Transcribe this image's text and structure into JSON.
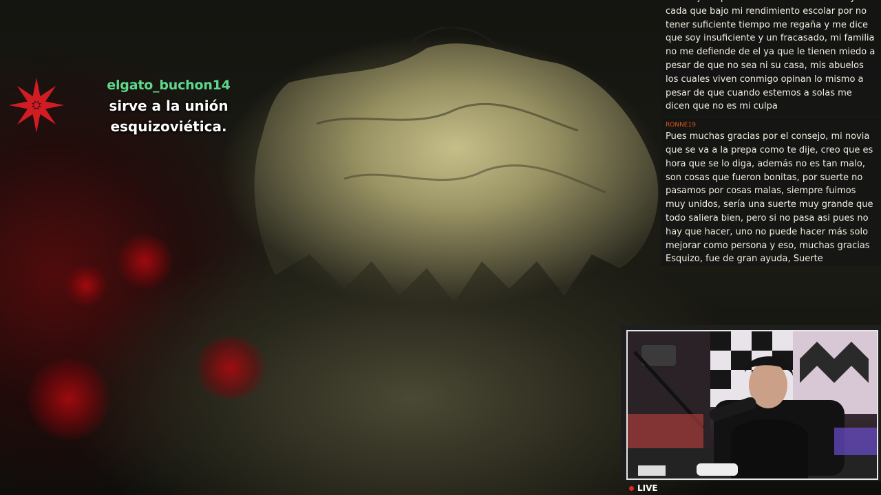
{
  "alert": {
    "username": "elgato_buchon14",
    "message_line1": "sirve a la unión",
    "message_line2": "esquizoviética.",
    "icon": "red-star-sigil-icon",
    "username_color": "#5ed88c"
  },
  "chat": {
    "messages": [
      {
        "username": "",
        "text": "a trabajar a pesar de ser menor de edad y cada que bajo mi rendimiento escolar por no tener suficiente tiempo me regaña y me dice que soy insuficiente y un fracasado, mi familia no me defiende de el ya que le tienen miedo a pesar de que no sea ni su casa, mis abuelos los cuales viven conmigo opinan lo mismo a pesar de que cuando estemos a solas me dicen que no es mi culpa"
      },
      {
        "username": "RONNE19",
        "text": "Pues muchas gracias por el consejo, mi novia que se va a la prepa como te dije, creo que es hora que se lo diga, además no es tan malo, son cosas que fueron bonitas, por suerte no pasamos por cosas malas, siempre fuimos muy unidos, sería una suerte muy grande que todo saliera bien, pero si no pasa asi pues no hay que hacer, uno no puede hacer más solo mejorar como persona y eso, muchas gracias Esquizo, fue de gran ayuda, Suerte"
      }
    ],
    "username_color": "#e05a1c"
  },
  "webcam": {
    "label": "webcam-feed"
  },
  "status": {
    "live_label": "LIVE",
    "live_color": "#e8242b"
  }
}
